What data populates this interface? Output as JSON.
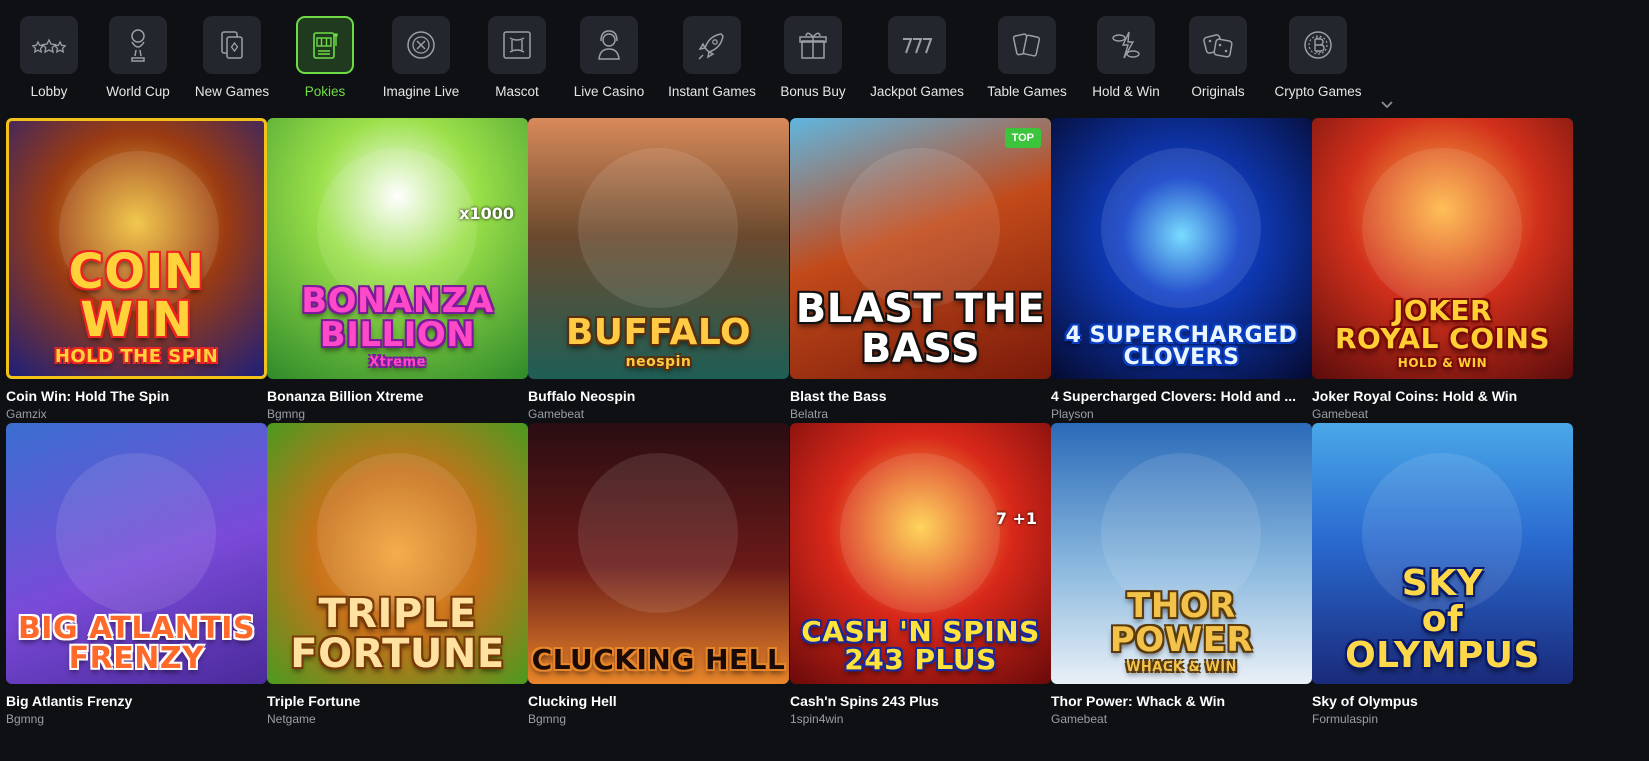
{
  "categories": [
    {
      "label": "Lobby",
      "icon": "stars-icon"
    },
    {
      "label": "World Cup",
      "icon": "trophy-icon"
    },
    {
      "label": "New Games",
      "icon": "cards-icon"
    },
    {
      "label": "Pokies",
      "icon": "slot-machine-icon",
      "active": true
    },
    {
      "label": "Imagine Live",
      "icon": "roulette-icon"
    },
    {
      "label": "Mascot",
      "icon": "mascot-icon"
    },
    {
      "label": "Live Casino",
      "icon": "dealer-icon"
    },
    {
      "label": "Instant Games",
      "icon": "rocket-icon"
    },
    {
      "label": "Bonus Buy",
      "icon": "gift-icon"
    },
    {
      "label": "Jackpot Games",
      "icon": "777-icon"
    },
    {
      "label": "Table Games",
      "icon": "table-cards-icon"
    },
    {
      "label": "Hold & Win",
      "icon": "coins-bolt-icon"
    },
    {
      "label": "Originals",
      "icon": "dice-icon"
    },
    {
      "label": "Crypto Games",
      "icon": "bitcoin-icon"
    }
  ],
  "colors": {
    "accent": "#6fdc45",
    "background": "#0e1014",
    "tile": "#23262c",
    "selected_border": "#f2c21a",
    "badge": "#3cc43c"
  },
  "games": [
    {
      "title": "Coin Win: Hold The Spin",
      "provider": "Gamzix",
      "art": "COIN\nWIN",
      "art_sub": "HOLD THE SPIN",
      "selected": true
    },
    {
      "title": "Bonanza Billion Xtreme",
      "provider": "Bgmng",
      "art": "BONANZA\nBILLION",
      "art_sub": "Xtreme",
      "art_extra": "x1000"
    },
    {
      "title": "Buffalo Neospin",
      "provider": "Gamebeat",
      "art": "BUFFALO",
      "art_sub": "neospin"
    },
    {
      "title": "Blast the Bass",
      "provider": "Belatra",
      "art": "BLAST THE\nBASS",
      "badge": "TOP"
    },
    {
      "title": "4 Supercharged Clovers: Hold and ...",
      "provider": "Playson",
      "art": "4 SUPERCHARGED\nCLOVERS"
    },
    {
      "title": "Joker Royal Coins: Hold & Win",
      "provider": "Gamebeat",
      "art": "JOKER\nROYAL COINS",
      "art_sub": "HOLD & WIN"
    },
    {
      "title": "Big Atlantis Frenzy",
      "provider": "Bgmng",
      "art": "BIG ATLANTIS\nFRENZY"
    },
    {
      "title": "Triple Fortune",
      "provider": "Netgame",
      "art": "TRIPLE\nFORTUNE"
    },
    {
      "title": "Clucking Hell",
      "provider": "Bgmng",
      "art": "CLUCKING HELL"
    },
    {
      "title": "Cash'n Spins 243 Plus",
      "provider": "1spin4win",
      "art": "CASH 'N SPINS\n243 PLUS",
      "art_extra": "7 +1"
    },
    {
      "title": "Thor Power: Whack & Win",
      "provider": "Gamebeat",
      "art": "THOR POWER",
      "art_sub": "WHACK & WIN"
    },
    {
      "title": "Sky of Olympus",
      "provider": "Formulaspin",
      "art": "SKY\nof\nOLYMPUS"
    }
  ]
}
